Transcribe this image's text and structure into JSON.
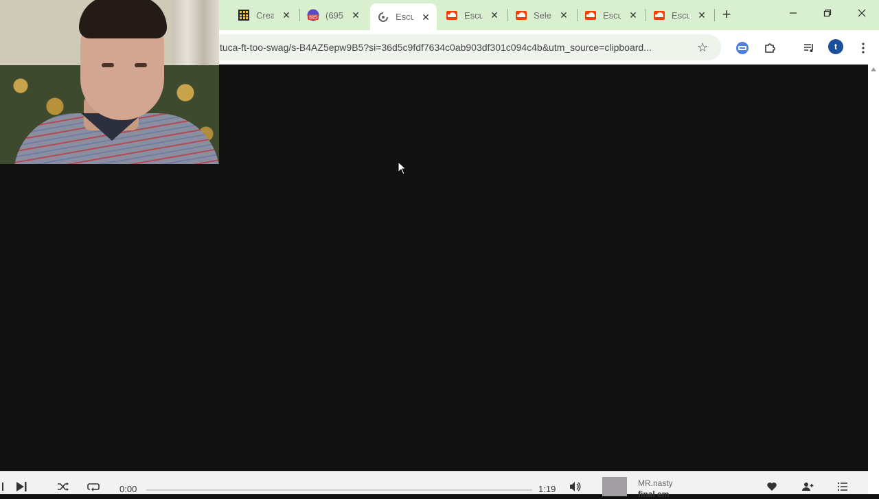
{
  "browser": {
    "tabs": [
      {
        "title": "Crea",
        "favicon": "grid-app-icon",
        "active": false
      },
      {
        "title": "(695",
        "favicon": "mail-badge-icon",
        "active": false
      },
      {
        "title": "Escu",
        "favicon": "loading-icon",
        "active": true
      },
      {
        "title": "Escu",
        "favicon": "soundcloud-icon",
        "active": false
      },
      {
        "title": "Sele",
        "favicon": "soundcloud-icon",
        "active": false
      },
      {
        "title": "Escu",
        "favicon": "soundcloud-icon",
        "active": false
      },
      {
        "title": "Escu",
        "favicon": "soundcloud-icon",
        "active": false
      }
    ],
    "mail_badge": "695",
    "address": "tuca-ft-too-swag/s-B4AZ5epw9B5?si=36d5c9fdf7634c0ab903df301c094c4b&utm_source=clipboard...",
    "profile_initial": "t"
  },
  "player": {
    "elapsed": "0:00",
    "duration": "1:19",
    "progress": 0,
    "artist": "MR.nasty",
    "track": "final em"
  },
  "colors": {
    "tabstrip": "#d8efd0",
    "page_bg": "#121212",
    "player_bg": "#f2f2f2",
    "accent": "#ff5500"
  }
}
